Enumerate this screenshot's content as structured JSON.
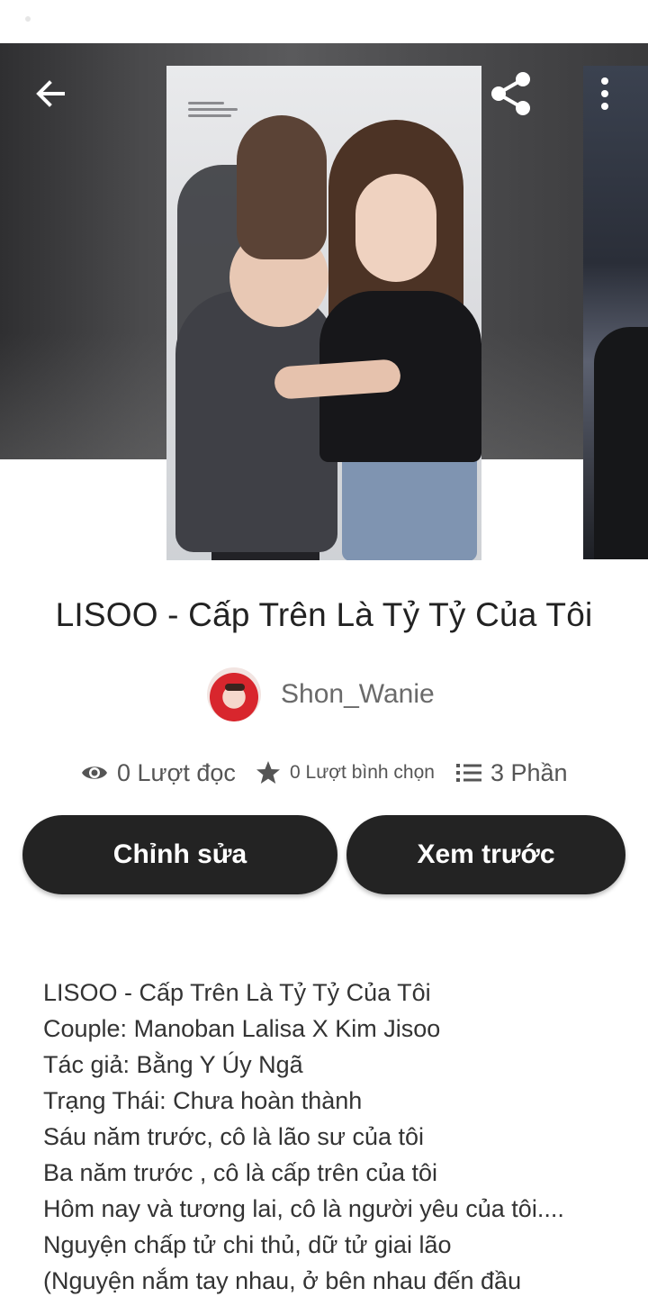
{
  "colors": {
    "button_bg": "#232323",
    "button_text": "#ffffff",
    "stat_text": "#555555",
    "author_text": "#6a6a6a"
  },
  "nav": {
    "back_icon": "arrow-left-icon",
    "share_icon": "share-icon",
    "more_icon": "more-vertical-icon"
  },
  "story": {
    "title": "LISOO - Cấp Trên Là Tỷ Tỷ Của Tôi",
    "author": "Shon_Wanie",
    "stats": {
      "reads": "0 Lượt đọc",
      "votes": "0 Lượt bình chọn",
      "parts": "3 Phần"
    }
  },
  "actions": {
    "edit_label": "Chỉnh sửa",
    "preview_label": "Xem trước"
  },
  "description": {
    "lines": [
      "LISOO - Cấp Trên Là Tỷ Tỷ Của Tôi",
      "Couple: Manoban Lalisa X Kim Jisoo",
      "Tác giả: Bằng Y Úy Ngã",
      "Trạng Thái: Chưa hoàn thành",
      "Sáu năm trước, cô là lão sư của tôi",
      "Ba năm trước , cô là cấp trên của tôi",
      "Hôm nay và tương lai, cô là người yêu của tôi....",
      "Nguyện chấp tử chi thủ, dữ tử giai lão",
      "(Nguyện nắm tay nhau, ở bên nhau đến đầu"
    ]
  }
}
